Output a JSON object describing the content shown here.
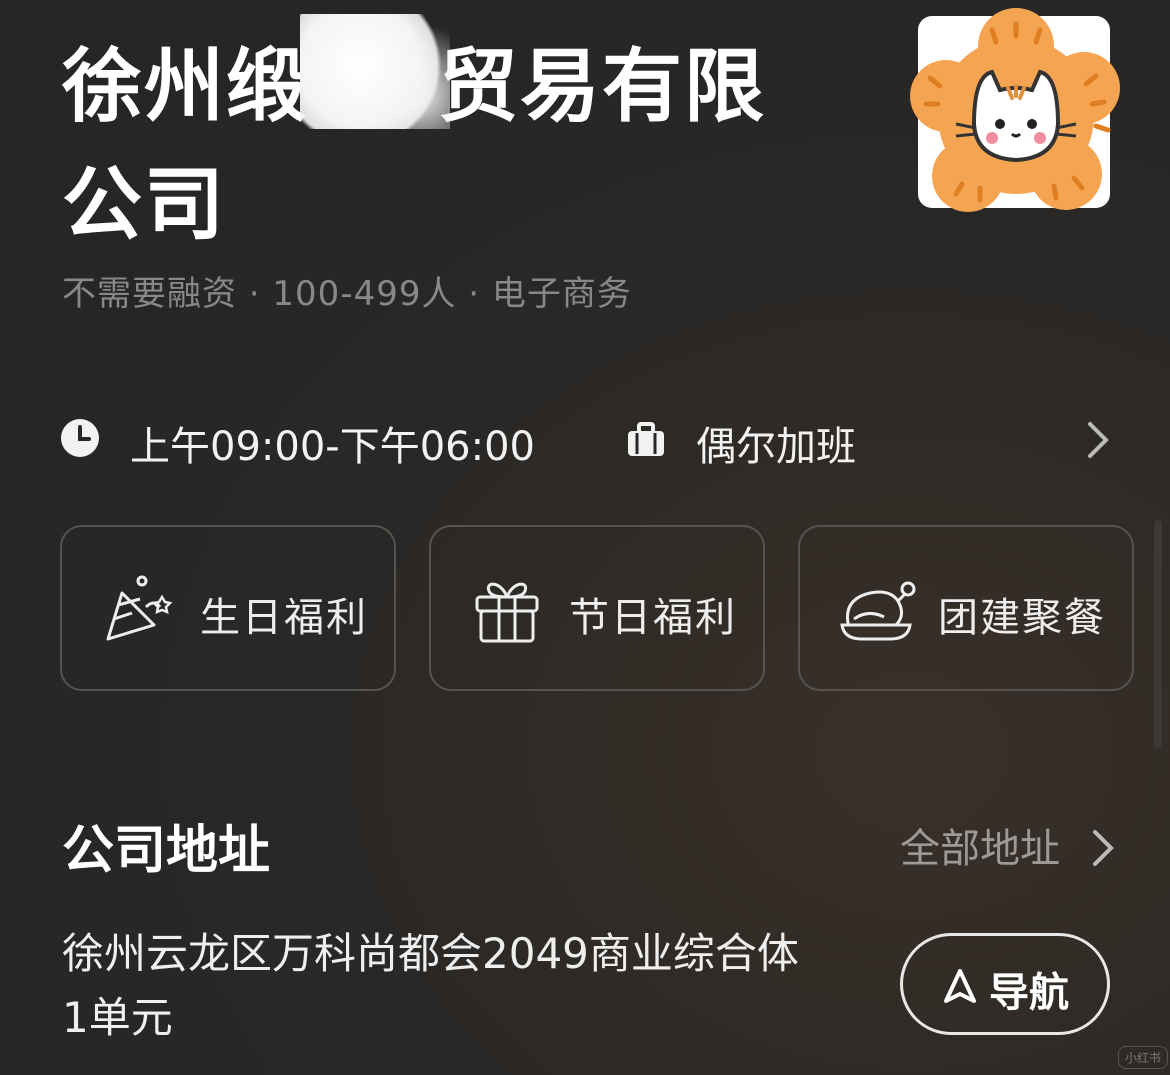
{
  "company": {
    "name_line1": "徐州缎",
    "name_line1_tail": "贸易有限",
    "name_line2": "公司",
    "meta": "不需要融资 · 100-499人 · 电子商务"
  },
  "logo": {
    "icon": "cat-face-icon",
    "colors": {
      "flower": "#f5a552",
      "bg": "#ffffff"
    }
  },
  "schedule": {
    "hours": "上午09:00-下午06:00",
    "overtime": "偶尔加班"
  },
  "benefits": [
    {
      "label": "生日福利",
      "icon": "party-popper-icon"
    },
    {
      "label": "节日福利",
      "icon": "gift-icon"
    },
    {
      "label": "团建聚餐",
      "icon": "roast-chicken-icon"
    }
  ],
  "address_section": {
    "title": "公司地址",
    "all_link": "全部地址",
    "address": "徐州云龙区万科尚都会2049商业综合体1单元",
    "nav_button": "导航"
  },
  "watermark": "小红书"
}
